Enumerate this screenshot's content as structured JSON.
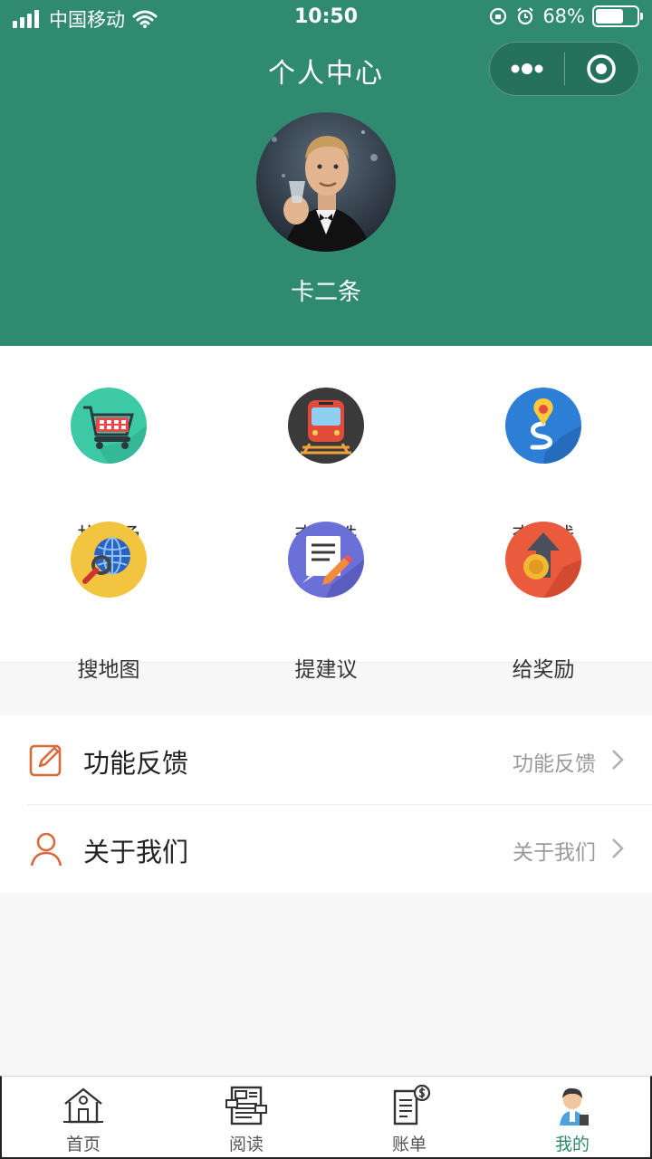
{
  "status_bar": {
    "carrier": "中国移动",
    "time": "10:50",
    "battery": "68%",
    "battery_level": 0.68
  },
  "nav": {
    "title": "个人中心",
    "more_icon": "more-dots-icon",
    "close_icon": "record-target-icon"
  },
  "profile": {
    "name": "卡二条"
  },
  "grid": [
    {
      "label": "找商场",
      "icon": "shopping-cart-icon",
      "color": "#3dc9a6"
    },
    {
      "label": "查地铁",
      "icon": "train-icon",
      "color": "#3a3a3a"
    },
    {
      "label": "查路线",
      "icon": "route-pin-icon",
      "color": "#2d7fd6"
    },
    {
      "label": "搜地图",
      "icon": "globe-search-icon",
      "color": "#f2c440"
    },
    {
      "label": "提建议",
      "icon": "edit-note-icon",
      "color": "#6b6fd8"
    },
    {
      "label": "给奖励",
      "icon": "coin-arrow-icon",
      "color": "#ea5a3c"
    }
  ],
  "list": [
    {
      "title": "功能反馈",
      "value": "功能反馈",
      "icon": "edit-icon"
    },
    {
      "title": "关于我们",
      "value": "关于我们",
      "icon": "user-icon"
    }
  ],
  "tabbar": [
    {
      "label": "首页",
      "icon": "house-icon"
    },
    {
      "label": "阅读",
      "icon": "newspaper-icon"
    },
    {
      "label": "账单",
      "icon": "bill-icon"
    },
    {
      "label": "我的",
      "icon": "person-icon"
    }
  ],
  "colors": {
    "brand": "#2f8a70",
    "accent_orange": "#d9693d"
  }
}
